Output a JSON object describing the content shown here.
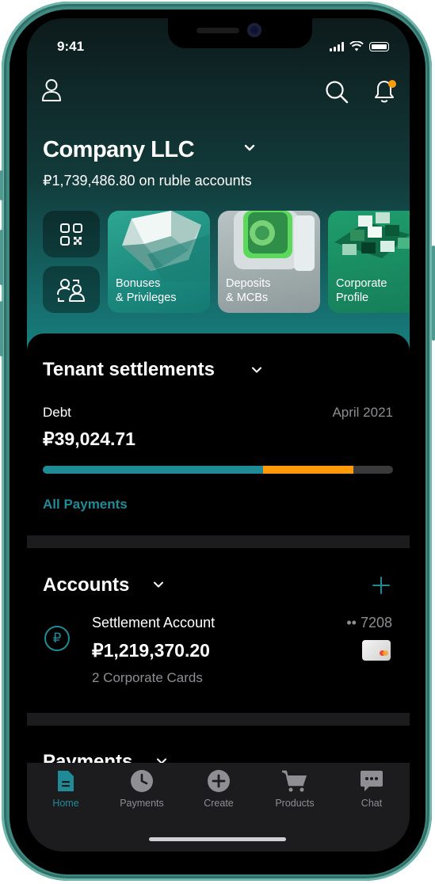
{
  "status_bar": {
    "time": "9:41"
  },
  "header": {
    "company_name": "Company LLC",
    "balance_text": "₽1,739,486.80 on ruble accounts"
  },
  "promos": [
    {
      "label_line1": "Bonuses",
      "label_line2": "& Privileges"
    },
    {
      "label_line1": "Deposits",
      "label_line2": "& MCBs"
    },
    {
      "label_line1": "Corporate",
      "label_line2": "Profile"
    }
  ],
  "tenant": {
    "title": "Tenant settlements",
    "debt_label": "Debt",
    "period": "April 2021",
    "amount": "₽39,024.71",
    "progress": {
      "paid_fraction": 0.629,
      "pending_fraction": 0.258
    },
    "link": "All Payments"
  },
  "accounts": {
    "title": "Accounts",
    "item": {
      "name": "Settlement Account",
      "masked_number": "•• 7208",
      "amount": "₽1,219,370.20",
      "cards": "2 Corporate Cards",
      "currency_symbol": "₽"
    }
  },
  "payments": {
    "title": "Payments"
  },
  "tabbar": {
    "items": [
      {
        "label": "Home",
        "icon": "document-icon",
        "active": true
      },
      {
        "label": "Payments",
        "icon": "clock-icon",
        "active": false
      },
      {
        "label": "Create",
        "icon": "plus-circle-icon",
        "active": false
      },
      {
        "label": "Products",
        "icon": "cart-icon",
        "active": false
      },
      {
        "label": "Chat",
        "icon": "chat-icon",
        "active": false
      }
    ]
  },
  "colors": {
    "accent": "#1e8b96",
    "warning": "#ff9a0a",
    "notification_dot": "#ff9a0a",
    "sheet_bg": "#000000",
    "tab_active": "#1e8b96",
    "tab_inactive": "#8e8e93"
  }
}
